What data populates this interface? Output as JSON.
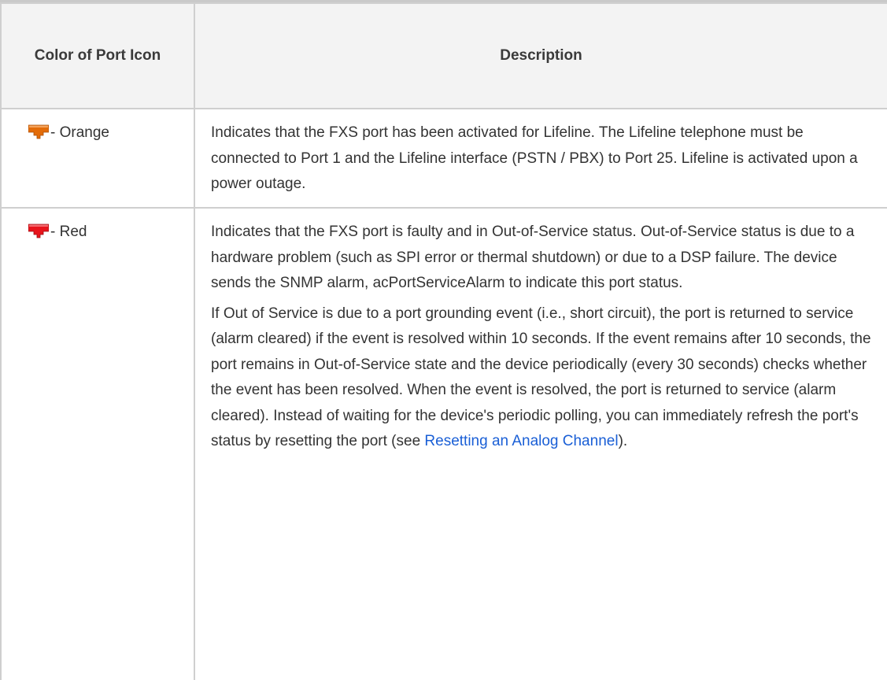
{
  "table": {
    "headers": {
      "color": "Color of Port Icon",
      "description": "Description"
    },
    "rows": [
      {
        "icon": "orange-port-icon",
        "icon_color": "#e36c09",
        "color_label": " - Orange",
        "paragraphs": [
          "Indicates that the FXS port has been activated for Lifeline. The Lifeline telephone must be connected to Port 1 and the Lifeline interface (PSTN / PBX) to Port 25. Lifeline is activated upon a power outage."
        ]
      },
      {
        "icon": "red-port-icon",
        "icon_color": "#e8141c",
        "color_label": " - Red",
        "paragraphs": [
          "Indicates that the FXS port is faulty and in Out-of-Service status. Out-of-Service status is due to a hardware problem (such as SPI error or thermal shutdown) or due to a DSP failure. The device sends the SNMP alarm, acPortServiceAlarm to indicate this port status."
        ],
        "paragraph2": {
          "text": "If Out of Service is due to a port grounding event (i.e., short circuit), the port is returned to service (alarm cleared) if the event is resolved within 10 seconds. If the event remains after 10 seconds, the port remains in Out-of-Service state and the device periodically (every 30 seconds) checks whether the event has been resolved. When the event is resolved, the port is returned to service (alarm cleared). Instead of waiting for the device's periodic polling, you can immediately refresh the port's status by resetting the port (see ",
          "link": "Resetting an Analog Channel",
          "suffix": ")."
        }
      }
    ]
  },
  "colors": {
    "header_bg": "#f3f3f3",
    "border": "#cfcfcf",
    "link": "#1a5fd6"
  }
}
